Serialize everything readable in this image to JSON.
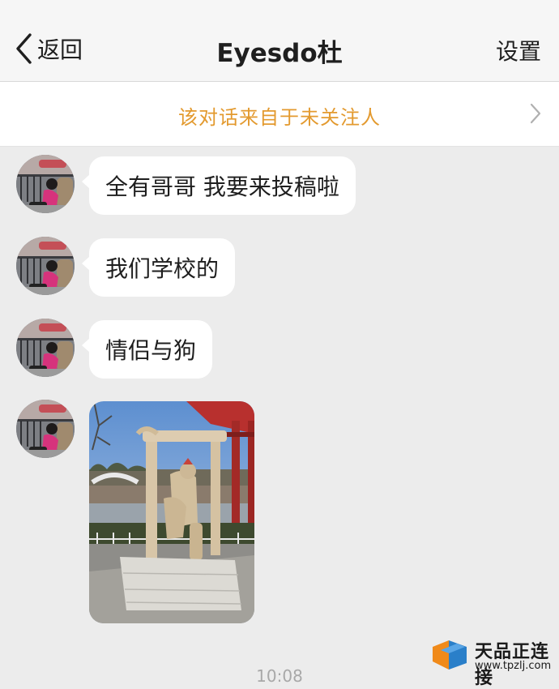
{
  "header": {
    "back_label": "返回",
    "title": "Eyesdo杜",
    "settings_label": "设置"
  },
  "notice": {
    "text": "该对话来自于未关注人",
    "icon": "chevron-right-icon"
  },
  "messages": [
    {
      "type": "text",
      "text": "全有哥哥 我要来投稿啦"
    },
    {
      "type": "text",
      "text": "我们学校的"
    },
    {
      "type": "text",
      "text": "情侣与狗"
    },
    {
      "type": "image",
      "description_icon": "photo-image"
    }
  ],
  "timestamp": "10:08",
  "watermark": {
    "title": "天品正连接",
    "url": "www.tpzlj.com"
  },
  "colors": {
    "notice_text": "#e39a2f",
    "chat_background": "#ececec",
    "bubble": "#ffffff",
    "navbar": "#f6f6f6"
  }
}
